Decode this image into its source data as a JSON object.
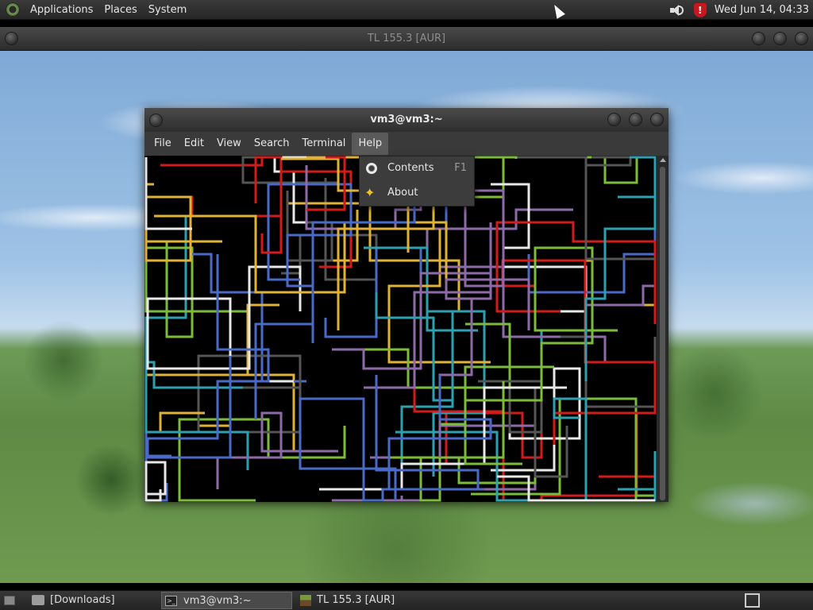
{
  "top_panel": {
    "menus": [
      "Applications",
      "Places",
      "System"
    ],
    "clock": "Wed Jun 14, 04:33"
  },
  "bg_window": {
    "title": "TL 155.3 [AUR]"
  },
  "terminal": {
    "title": "vm3@vm3:~",
    "menu": [
      "File",
      "Edit",
      "View",
      "Search",
      "Terminal",
      "Help"
    ],
    "active_menu": "Help",
    "pipe_colors": [
      "#d21c1c",
      "#e0b23a",
      "#2ea0b0",
      "#7dbb3c",
      "#8e6aa8",
      "#4a6ac8",
      "#e8e8e8",
      "#555555"
    ]
  },
  "help_menu": {
    "items": [
      {
        "label": "Contents",
        "accel": "F1",
        "icon": "lifebuoy-icon"
      },
      {
        "label": "About",
        "accel": "",
        "icon": "star-icon"
      }
    ]
  },
  "taskbar": {
    "tasks": [
      {
        "label": "[Downloads]",
        "icon": "folder-icon"
      },
      {
        "label": "vm3@vm3:~",
        "icon": "terminal-icon",
        "active": true
      },
      {
        "label": "TL 155.3 [AUR]",
        "icon": "cube-icon"
      }
    ]
  }
}
